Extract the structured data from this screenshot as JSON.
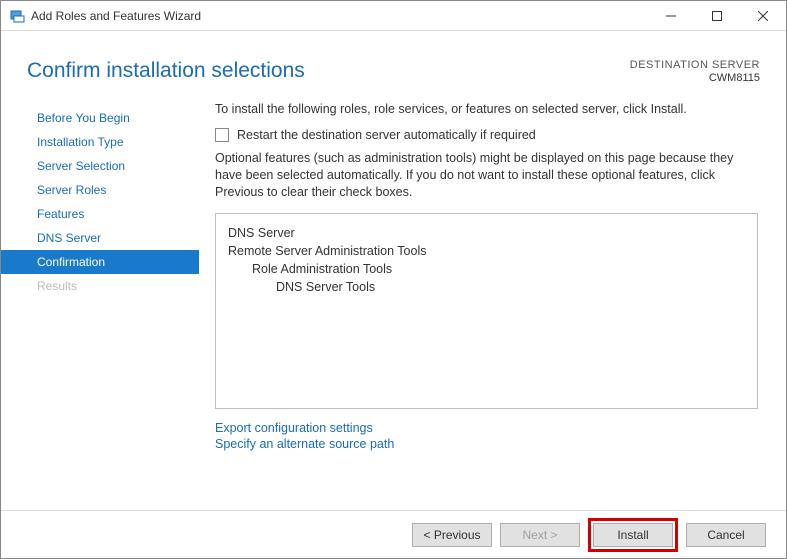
{
  "titlebar": {
    "title": "Add Roles and Features Wizard"
  },
  "header": {
    "page_title": "Confirm installation selections",
    "destination_label": "DESTINATION SERVER",
    "destination_server": "CWM8115"
  },
  "nav": {
    "items": [
      {
        "label": "Before You Begin"
      },
      {
        "label": "Installation Type"
      },
      {
        "label": "Server Selection"
      },
      {
        "label": "Server Roles"
      },
      {
        "label": "Features"
      },
      {
        "label": "DNS Server"
      },
      {
        "label": "Confirmation"
      },
      {
        "label": "Results"
      }
    ]
  },
  "main": {
    "intro": "To install the following roles, role services, or features on selected server, click Install.",
    "restart_checkbox_label": "Restart the destination server automatically if required",
    "note": "Optional features (such as administration tools) might be displayed on this page because they have been selected automatically. If you do not want to install these optional features, click Previous to clear their check boxes.",
    "features": {
      "l1a": "DNS Server",
      "l1b": "Remote Server Administration Tools",
      "l2a": "Role Administration Tools",
      "l3a": "DNS Server Tools"
    },
    "links": {
      "export": "Export configuration settings",
      "specify": "Specify an alternate source path"
    }
  },
  "footer": {
    "previous": "< Previous",
    "next": "Next >",
    "install": "Install",
    "cancel": "Cancel"
  }
}
